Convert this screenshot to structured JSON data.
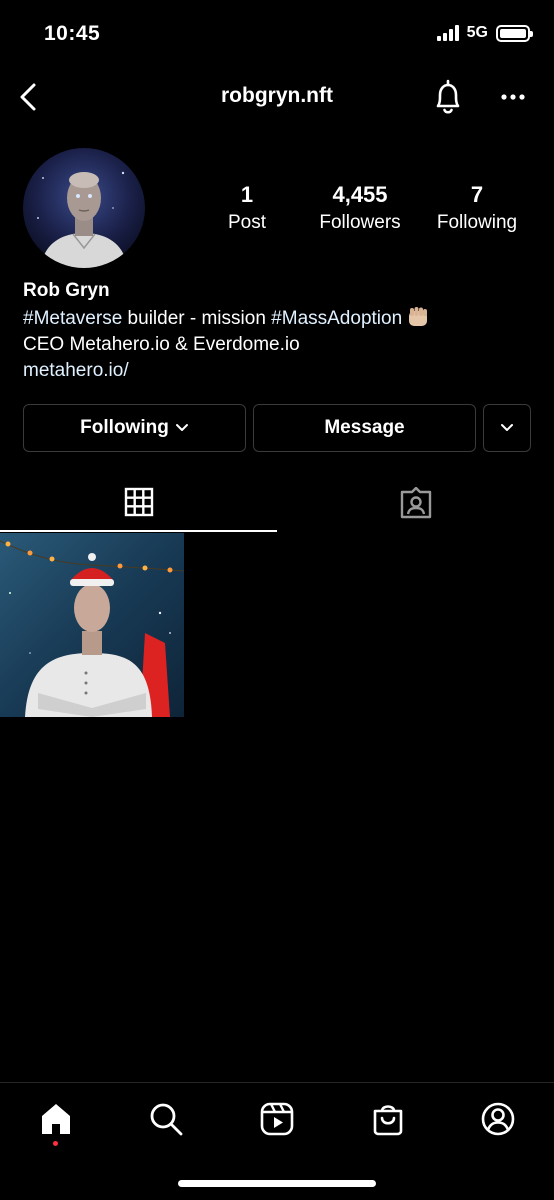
{
  "status_bar": {
    "time": "10:45",
    "network": "5G"
  },
  "header": {
    "username": "robgryn.nft"
  },
  "stats": [
    {
      "value": "1",
      "label": "Post"
    },
    {
      "value": "4,455",
      "label": "Followers"
    },
    {
      "value": "7",
      "label": "Following"
    }
  ],
  "bio": {
    "name": "Rob Gryn",
    "line1_hashtag1": "#Metaverse",
    "line1_text": " builder - mission ",
    "line1_hashtag2": "#MassAdoption",
    "line2": "CEO Metahero.io & Everdome.io",
    "link": "metahero.io/"
  },
  "actions": {
    "following_label": "Following",
    "message_label": "Message"
  },
  "tabs": [
    "grid-icon",
    "tagged-icon"
  ],
  "nav": [
    "home-icon",
    "search-icon",
    "reels-icon",
    "shop-icon",
    "profile-icon"
  ],
  "colors": {
    "background": "#000000",
    "notification_dot": "#ff3040",
    "border": "#3a3a3a"
  }
}
